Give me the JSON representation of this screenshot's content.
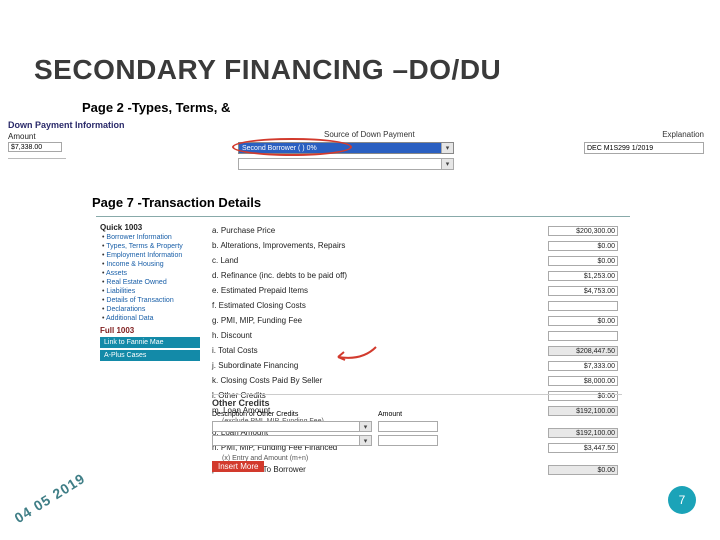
{
  "title": "SECONDARY FINANCING –DO/DU",
  "sub1": "Page 2 -Types, Terms, &",
  "sub2": "Page 7 -Transaction Details",
  "page2": {
    "dp_info": "Down Payment Information",
    "amount_lbl": "Amount",
    "amount_val": "$7,338.00",
    "source_lbl": "Source of Down Payment",
    "source_val": "Second Borrower (  )  0%",
    "explanation_lbl": "Explanation",
    "explanation_val": "DEC M1S299 1/2019"
  },
  "nav": {
    "q1003": "Quick 1003",
    "links": [
      "Borrower Information",
      "Types, Terms & Property",
      "Employment Information",
      "Income & Housing",
      "Assets",
      "Real Estate Owned",
      "Liabilities",
      "Details of Transaction",
      "Declarations",
      "Additional Data"
    ],
    "full1003": "Full 1003",
    "bar1": "Link to Fannie Mae",
    "bar2": "A-Plus Cases"
  },
  "rows": [
    {
      "lbl": "a. Purchase Price",
      "val": "$200,300.00"
    },
    {
      "lbl": "b. Alterations, Improvements, Repairs",
      "val": "$0.00"
    },
    {
      "lbl": "c. Land",
      "val": "$0.00"
    },
    {
      "lbl": "d. Refinance (inc. debts to be paid off)",
      "val": "$1,253.00"
    },
    {
      "lbl": "e. Estimated Prepaid Items",
      "val": "$4,753.00"
    },
    {
      "lbl": "f. Estimated Closing Costs",
      "val": ""
    },
    {
      "lbl": "g. PMI, MIP, Funding Fee",
      "val": "$0.00"
    },
    {
      "lbl": "h. Discount",
      "val": ""
    },
    {
      "lbl": "i. Total Costs",
      "val": "$208,447.50",
      "grey": true
    },
    {
      "lbl": "j. Subordinate Financing",
      "val": "$7,333.00"
    },
    {
      "lbl": "k. Closing Costs Paid By Seller",
      "val": "$8,000.00"
    },
    {
      "lbl": "l. Other Credits",
      "val": "$0.00"
    },
    {
      "lbl": "m. Loan Amount",
      "val": "$192,100.00",
      "grey": true
    },
    {
      "lbl": "o. Loan Amount",
      "val": "$192,100.00",
      "grey": true
    },
    {
      "lbl": "n. PMI, MIP, Funding Fee Financed",
      "val": "$3,447.50"
    },
    {
      "lbl": "p. Cash From/To Borrower",
      "val": "$0.00",
      "grey": true
    }
  ],
  "row_note1": "(exclude PMI, MIP, Funding Fee)",
  "row_note2": "(x) Entry and Amount (m+n)",
  "other_credits": {
    "head": "Other Credits",
    "desc_lbl": "Description of Other Credits",
    "amt_lbl": "Amount"
  },
  "mass_btn": "Insert More",
  "date": "04 05 2019",
  "slide_num": "7"
}
